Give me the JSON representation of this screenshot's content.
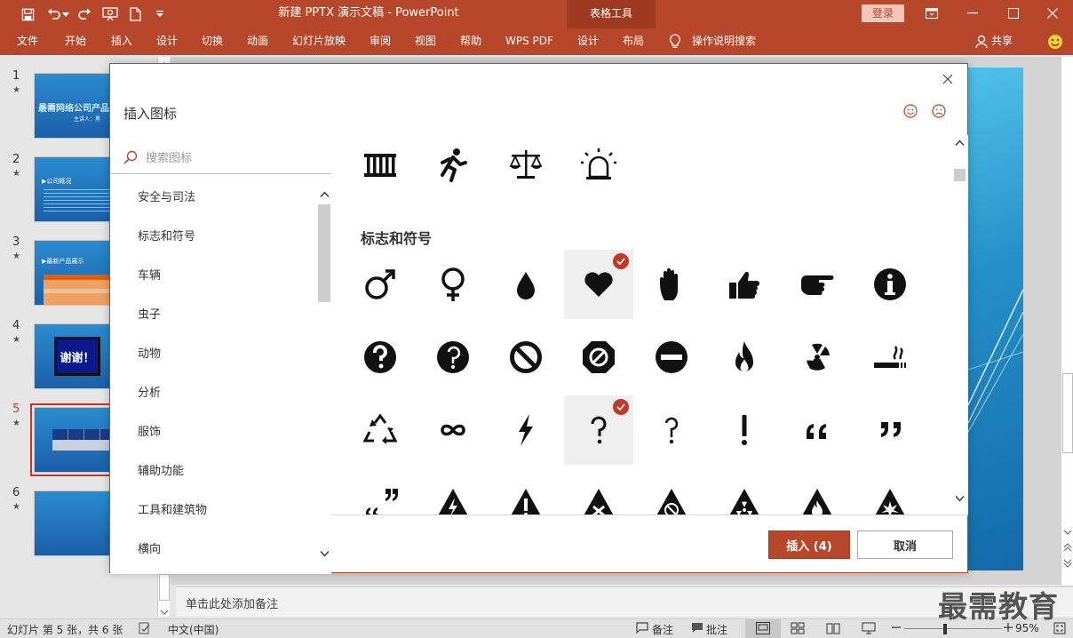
{
  "window": {
    "title": "新建 PPTX 演示文稿  -  PowerPoint",
    "context_tab": "表格工具",
    "login": "登录",
    "accent": "#b7472a"
  },
  "ribbon": {
    "tabs": [
      "文件",
      "开始",
      "插入",
      "设计",
      "切换",
      "动画",
      "幻灯片放映",
      "审阅",
      "视图",
      "帮助",
      "WPS PDF",
      "设计",
      "布局"
    ],
    "tell_me": "操作说明搜索",
    "share": "共享"
  },
  "slides": [
    {
      "num": "1",
      "title": "最需网络公司产品",
      "sub": "主讲人：黑"
    },
    {
      "num": "2",
      "title": "▶公司概况"
    },
    {
      "num": "3",
      "title": "▶最新产品展示"
    },
    {
      "num": "4",
      "text": "谢谢！"
    },
    {
      "num": "5"
    },
    {
      "num": "6"
    }
  ],
  "dialog": {
    "title": "插入图标",
    "search_placeholder": "搜索图标",
    "categories": [
      "安全与司法",
      "标志和符号",
      "车辆",
      "虫子",
      "动物",
      "分析",
      "服饰",
      "辅助功能",
      "工具和建筑物",
      "横向"
    ],
    "section_heading": "标志和符号",
    "insert_label": "插入 (4)",
    "cancel_label": "取消",
    "top_icons": [
      "jail-cell-icon",
      "running-person-icon",
      "justice-scale-icon",
      "siren-icon"
    ],
    "icon_rows": [
      [
        "male-symbol-icon",
        "female-symbol-icon",
        "water-drop-icon",
        "heart-icon",
        "stop-hand-icon",
        "thumbs-up-icon",
        "pointing-hand-icon",
        "info-icon"
      ],
      [
        "question-circle-icon",
        "question-circle-alt-icon",
        "prohibited-icon",
        "octagon-prohibited-icon",
        "no-entry-icon",
        "flame-icon",
        "radiation-icon",
        "smoking-icon"
      ],
      [
        "recycle-icon",
        "infinity-icon",
        "lightning-icon",
        "question-mark-icon",
        "question-hook-icon",
        "exclamation-icon",
        "open-quote-icon",
        "close-quote-icon"
      ],
      [
        "quote-pair-icon",
        "high-voltage-warning-icon",
        "exclamation-warning-icon",
        "x-warning-icon",
        "no-smoking-warning-icon",
        "radiation-warning-icon",
        "flammable-warning-icon",
        "explosive-warning-icon"
      ]
    ]
  },
  "notes": {
    "placeholder": "单击此处添加备注"
  },
  "status": {
    "slide_info": "幻灯片 第 5 张，共 6 张",
    "language": "中文(中国)",
    "notes_btn": "备注",
    "comments_btn": "批注",
    "zoom": "95%"
  },
  "watermark": "最需教育"
}
